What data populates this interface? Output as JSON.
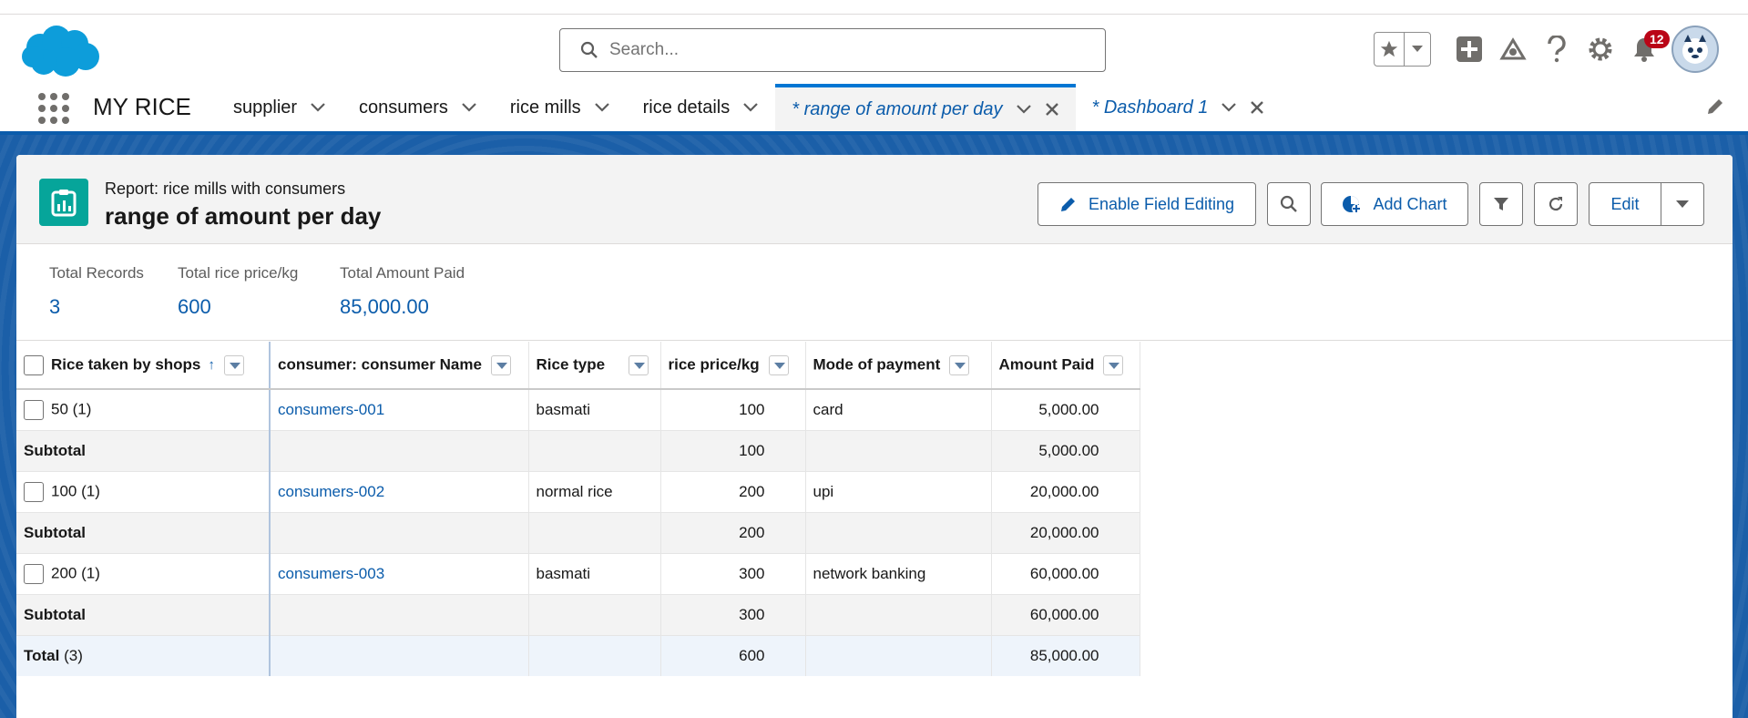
{
  "header": {
    "search_placeholder": "Search...",
    "notification_count": "12"
  },
  "nav": {
    "app_name": "MY RICE",
    "tabs": [
      {
        "label": "supplier"
      },
      {
        "label": "consumers"
      },
      {
        "label": "rice mills"
      },
      {
        "label": "rice details"
      },
      {
        "label": "* range of amount per day"
      },
      {
        "label": "* Dashboard 1"
      }
    ]
  },
  "report": {
    "subtitle": "Report: rice mills with consumers",
    "title": "range of amount per day",
    "buttons": {
      "enable_field_editing": "Enable Field Editing",
      "add_chart": "Add Chart",
      "edit": "Edit"
    }
  },
  "summary": [
    {
      "label": "Total Records",
      "value": "3"
    },
    {
      "label": "Total rice price/kg",
      "value": "600"
    },
    {
      "label": "Total Amount Paid",
      "value": "85,000.00"
    }
  ],
  "table": {
    "columns": [
      "Rice taken by shops",
      "consumer: consumer Name",
      "Rice type",
      "rice price/kg",
      "Mode of payment",
      "Amount Paid"
    ],
    "groups": [
      {
        "group": "50 (1)",
        "name": "consumers-001",
        "type": "basmati",
        "price": "100",
        "mode": "card",
        "amount": "5,000.00",
        "sub_price": "100",
        "sub_amount": "5,000.00"
      },
      {
        "group": "100 (1)",
        "name": "consumers-002",
        "type": "normal rice",
        "price": "200",
        "mode": "upi",
        "amount": "20,000.00",
        "sub_price": "200",
        "sub_amount": "20,000.00"
      },
      {
        "group": "200 (1)",
        "name": "consumers-003",
        "type": "basmati",
        "price": "300",
        "mode": "network banking",
        "amount": "60,000.00",
        "sub_price": "300",
        "sub_amount": "60,000.00"
      }
    ],
    "subtotal_label": "Subtotal",
    "total_label": "Total",
    "total_count": "(3)",
    "total_price": "600",
    "total_amount": "85,000.00"
  }
}
